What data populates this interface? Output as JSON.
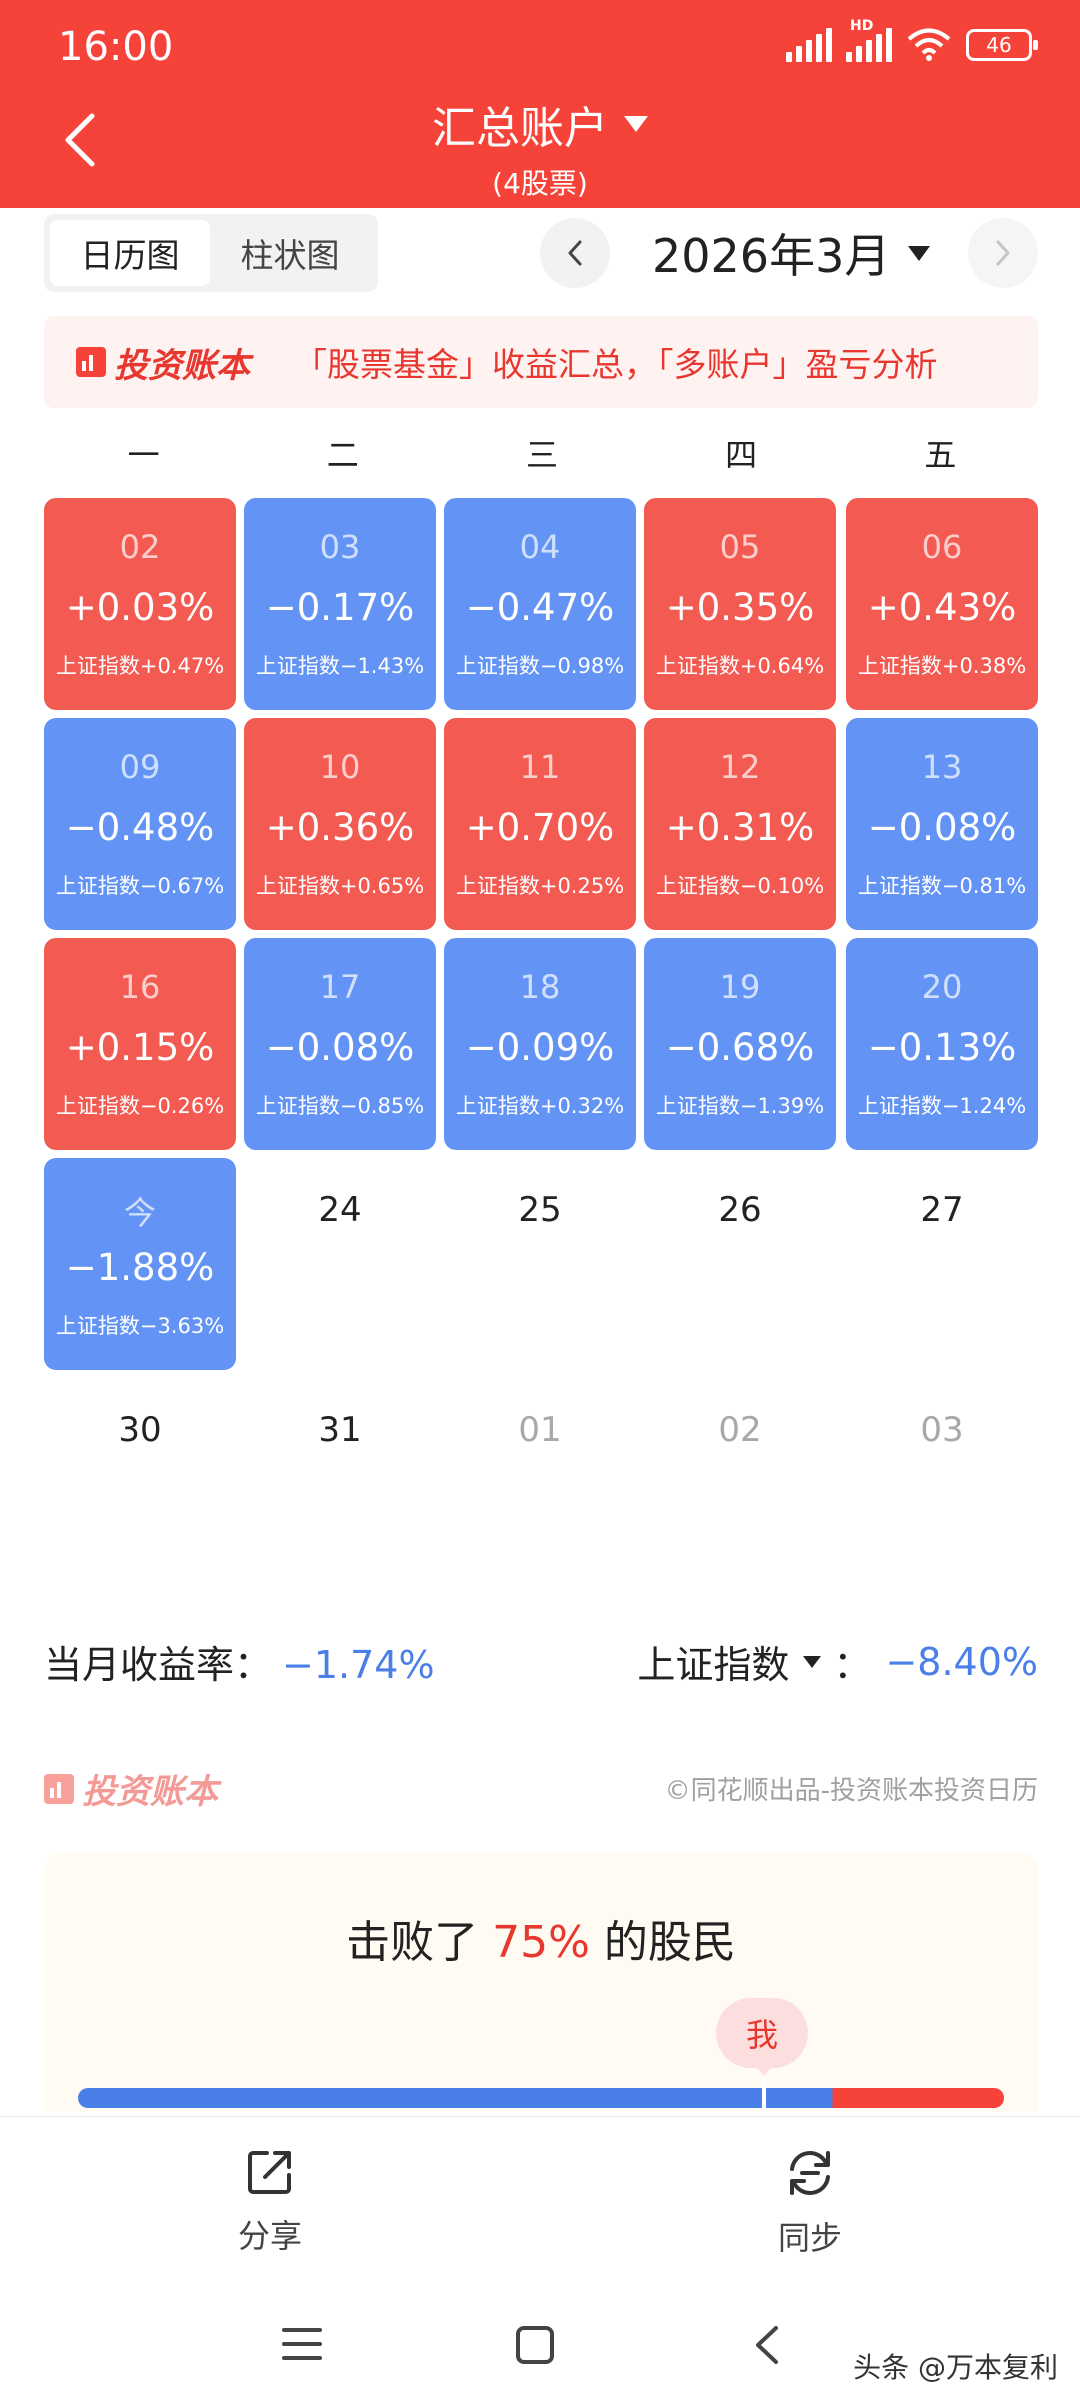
{
  "status_bar": {
    "time": "16:00",
    "network": "HD",
    "battery": "46"
  },
  "header": {
    "title": "汇总账户",
    "subtitle": "(4股票)"
  },
  "view_toggle": {
    "calendar_label": "日历图",
    "bar_label": "柱状图",
    "selected": "日历图"
  },
  "month": {
    "label": "2026年3月"
  },
  "banner": {
    "brand": "投资账本",
    "text": "「股票基金」收益汇总，「多账户」盈亏分析"
  },
  "weekdays": [
    "一",
    "二",
    "三",
    "四",
    "五"
  ],
  "days": [
    {
      "date": "02",
      "pct": "+0.03%",
      "index": "上证指数+0.47%",
      "color": "#f25a52"
    },
    {
      "date": "03",
      "pct": "−0.17%",
      "index": "上证指数−1.43%",
      "color": "#6394f5"
    },
    {
      "date": "04",
      "pct": "−0.47%",
      "index": "上证指数−0.98%",
      "color": "#6394f5"
    },
    {
      "date": "05",
      "pct": "+0.35%",
      "index": "上证指数+0.64%",
      "color": "#f25a52"
    },
    {
      "date": "06",
      "pct": "+0.43%",
      "index": "上证指数+0.38%",
      "color": "#f25a52"
    },
    {
      "date": "09",
      "pct": "−0.48%",
      "index": "上证指数−0.67%",
      "color": "#6394f5"
    },
    {
      "date": "10",
      "pct": "+0.36%",
      "index": "上证指数+0.65%",
      "color": "#f25a52"
    },
    {
      "date": "11",
      "pct": "+0.70%",
      "index": "上证指数+0.25%",
      "color": "#f25a52"
    },
    {
      "date": "12",
      "pct": "+0.31%",
      "index": "上证指数−0.10%",
      "color": "#f25a52"
    },
    {
      "date": "13",
      "pct": "−0.08%",
      "index": "上证指数−0.81%",
      "color": "#6394f5"
    },
    {
      "date": "16",
      "pct": "+0.15%",
      "index": "上证指数−0.26%",
      "color": "#f25a52"
    },
    {
      "date": "17",
      "pct": "−0.08%",
      "index": "上证指数−0.85%",
      "color": "#6394f5"
    },
    {
      "date": "18",
      "pct": "−0.09%",
      "index": "上证指数+0.32%",
      "color": "#6394f5"
    },
    {
      "date": "19",
      "pct": "−0.68%",
      "index": "上证指数−1.39%",
      "color": "#6394f5"
    },
    {
      "date": "20",
      "pct": "−0.13%",
      "index": "上证指数−1.24%",
      "color": "#6394f5"
    },
    {
      "date": "今",
      "pct": "−1.88%",
      "index": "上证指数−3.63%",
      "color": "#6394f5"
    }
  ],
  "empty_days": [
    {
      "label": "24",
      "muted": false
    },
    {
      "label": "25",
      "muted": false
    },
    {
      "label": "26",
      "muted": false
    },
    {
      "label": "27",
      "muted": false
    },
    {
      "label": "30",
      "muted": false
    },
    {
      "label": "31",
      "muted": false
    },
    {
      "label": "01",
      "muted": true
    },
    {
      "label": "02",
      "muted": true
    },
    {
      "label": "03",
      "muted": true
    }
  ],
  "summary": {
    "month_return_label": "当月收益率：",
    "month_return_value": "−1.74%",
    "index_label": "上证指数",
    "index_separator": "：",
    "index_value": "−8.40%"
  },
  "footer": {
    "brand": "投资账本",
    "copyright": "©同花顺出品-投资账本投资日历"
  },
  "beat": {
    "prefix": "击败了",
    "percent": "75%",
    "suffix": "的股民",
    "me_label": "我",
    "beat_fraction": 0.75
  },
  "actions": {
    "share_label": "分享",
    "sync_label": "同步"
  },
  "watermark": "头条 @万本复利",
  "colors": {
    "header": "#f5433a",
    "gain": "#f25a52",
    "loss": "#6394f5",
    "loss_text": "#4a7fe8"
  }
}
